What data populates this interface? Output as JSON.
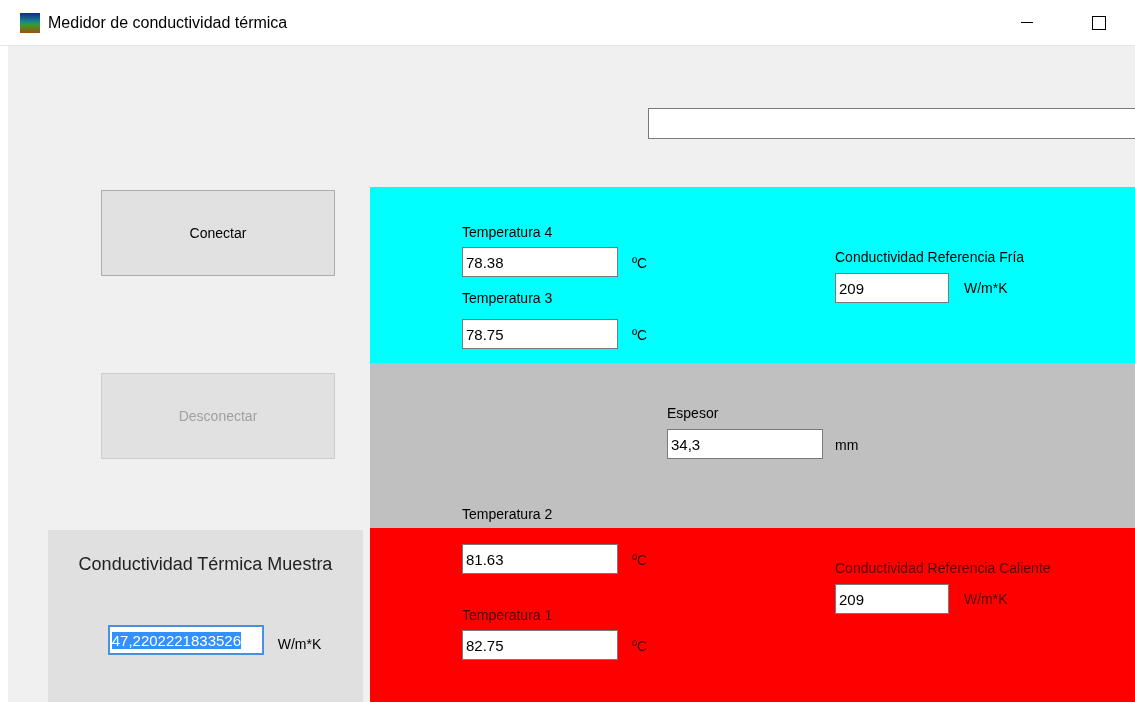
{
  "window": {
    "title": "Medidor de conductividad térmica"
  },
  "buttons": [
    {
      "label": "Conectar",
      "disabled": false
    },
    {
      "label": "Desconectar",
      "disabled": true
    }
  ],
  "sample": {
    "title": "Conductividad Térmica Muestra",
    "value": "47,2202221833526",
    "selected": true,
    "unit": "W/m*K"
  },
  "cold_zone": {
    "color": "#00ffff",
    "temperatures": [
      {
        "label": "Temperatura 4",
        "value": "78.38",
        "unit": "ºC"
      },
      {
        "label": "Temperatura 3",
        "value": "78.75",
        "unit": "ºC"
      }
    ],
    "reference": {
      "label": "Conductividad Referencia Fría",
      "value": "209",
      "unit": "W/m*K"
    }
  },
  "sample_zone": {
    "color": "#c0c0c0",
    "thickness": {
      "label": "Espesor",
      "value": "34,3",
      "unit": "mm"
    },
    "bottom_label": "Temperatura 2"
  },
  "hot_zone": {
    "color": "#ff0000",
    "temperatures": [
      {
        "value": "81.63",
        "unit": "ºC"
      },
      {
        "label": "Temperatura 1",
        "value": "82.75",
        "unit": "ºC"
      }
    ],
    "reference": {
      "label": "Conductividad Referencia Caliente",
      "value": "209",
      "unit": "W/m*K"
    }
  }
}
